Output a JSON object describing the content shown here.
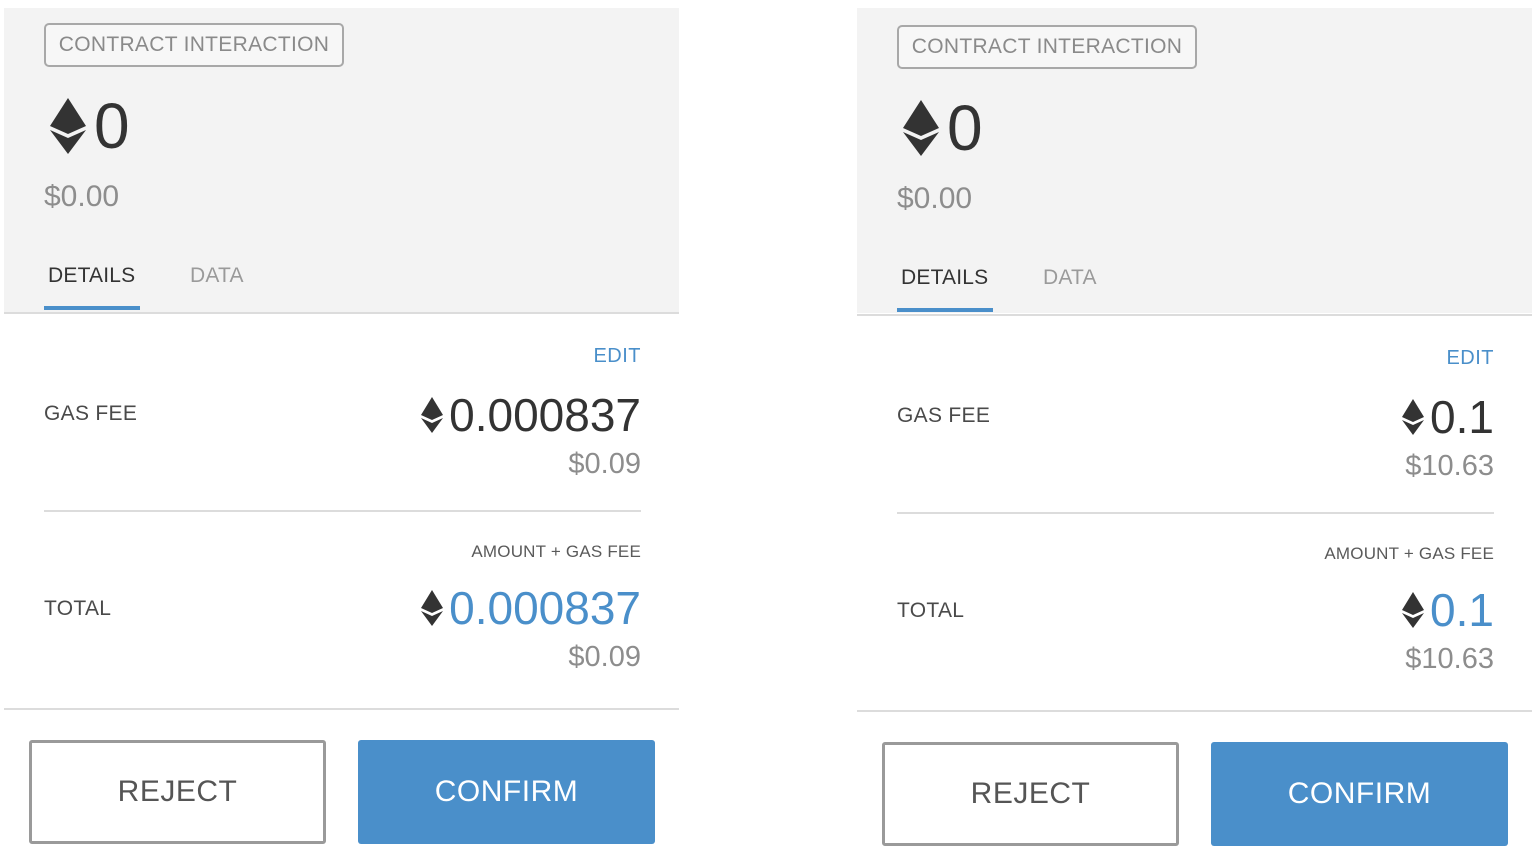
{
  "colors": {
    "accent": "#4a8fca",
    "text_dark": "#333333",
    "text_muted": "#8d8d8d"
  },
  "icons": {
    "ether": "ethereum-diamond-icon"
  },
  "left": {
    "badge": "CONTRACT INTERACTION",
    "amount": "0",
    "amount_fiat": "$0.00",
    "tabs": {
      "details": "DETAILS",
      "data": "DATA",
      "active": "DETAILS"
    },
    "edit": "EDIT",
    "gas_fee": {
      "label": "GAS FEE",
      "value": "0.000837",
      "fiat": "$0.09"
    },
    "total": {
      "sublabel": "AMOUNT + GAS FEE",
      "label": "TOTAL",
      "value": "0.000837",
      "fiat": "$0.09"
    },
    "buttons": {
      "reject": "REJECT",
      "confirm": "CONFIRM"
    }
  },
  "right": {
    "badge": "CONTRACT INTERACTION",
    "amount": "0",
    "amount_fiat": "$0.00",
    "tabs": {
      "details": "DETAILS",
      "data": "DATA",
      "active": "DETAILS"
    },
    "edit": "EDIT",
    "gas_fee": {
      "label": "GAS FEE",
      "value": "0.1",
      "fiat": "$10.63"
    },
    "total": {
      "sublabel": "AMOUNT + GAS FEE",
      "label": "TOTAL",
      "value": "0.1",
      "fiat": "$10.63"
    },
    "buttons": {
      "reject": "REJECT",
      "confirm": "CONFIRM"
    }
  }
}
